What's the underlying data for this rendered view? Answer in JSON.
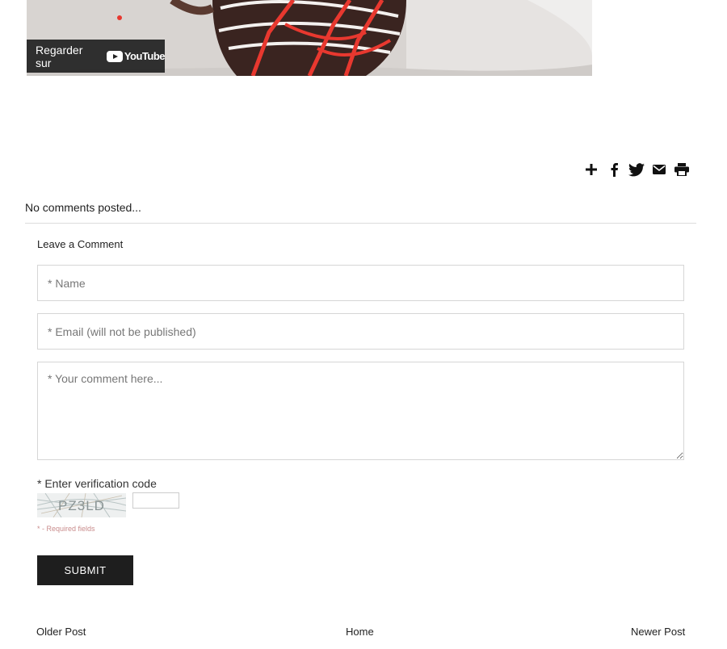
{
  "video": {
    "watch_on_label": "Regarder sur",
    "platform_logo_text": "YouTube",
    "platform_icon": "youtube-play-icon"
  },
  "share": {
    "icons": [
      "plus-icon",
      "facebook-icon",
      "twitter-icon",
      "email-icon",
      "print-icon"
    ]
  },
  "comments": {
    "status": "No comments posted...",
    "form_title": "Leave a Comment",
    "name_placeholder": "* Name",
    "email_placeholder": "* Email (will not be published)",
    "comment_placeholder": "* Your comment here...",
    "verification_label": "* Enter verification code",
    "captcha_text": "PZ3LD",
    "required_note": "* - Required fields",
    "submit_label": "SUBMIT"
  },
  "pagination": {
    "older": "Older Post",
    "home": "Home",
    "newer": "Newer Post"
  },
  "colors": {
    "button_bg": "#1e1e1e",
    "required_note": "#c98c8c",
    "frosting_red": "#e8382f"
  }
}
